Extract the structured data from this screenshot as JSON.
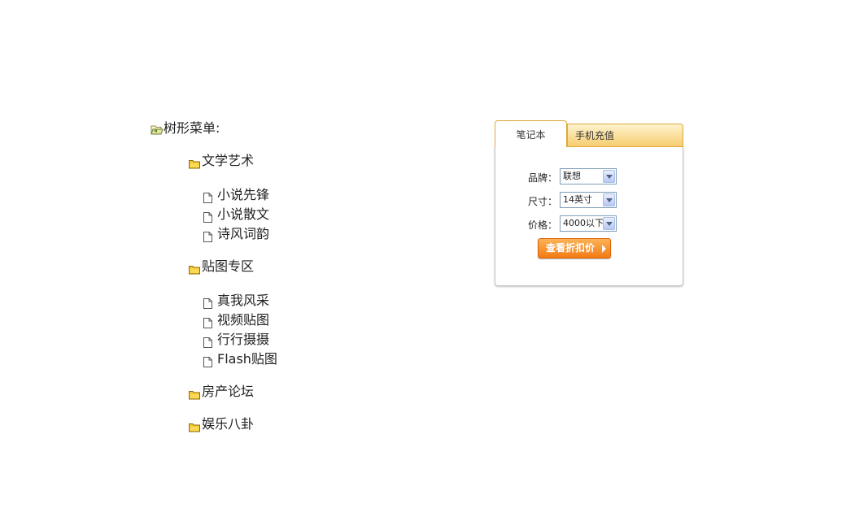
{
  "tree": {
    "root_label": "树形菜单:",
    "folders": [
      {
        "label": "文学艺术",
        "items": [
          "小说先锋",
          "小说散文",
          "诗风词韵"
        ]
      },
      {
        "label": "贴图专区",
        "items": [
          "真我风采",
          "视频贴图",
          "行行摄摄",
          "Flash贴图"
        ]
      },
      {
        "label": "房产论坛",
        "items": []
      },
      {
        "label": "娱乐八卦",
        "items": []
      }
    ]
  },
  "widget": {
    "tabs": [
      "笔记本",
      "手机充值"
    ],
    "active_tab": "笔记本",
    "form": {
      "brand_label": "品牌：",
      "brand_value": "联想",
      "size_label": "尺寸：",
      "size_value": "14英寸",
      "price_label": "价格：",
      "price_value": "4000以下"
    },
    "button_label": "查看折扣价"
  },
  "colors": {
    "tab_border": "#e0a73a",
    "tab_inactive_bg": "#f6cd70",
    "button_orange": "#f47b14"
  }
}
